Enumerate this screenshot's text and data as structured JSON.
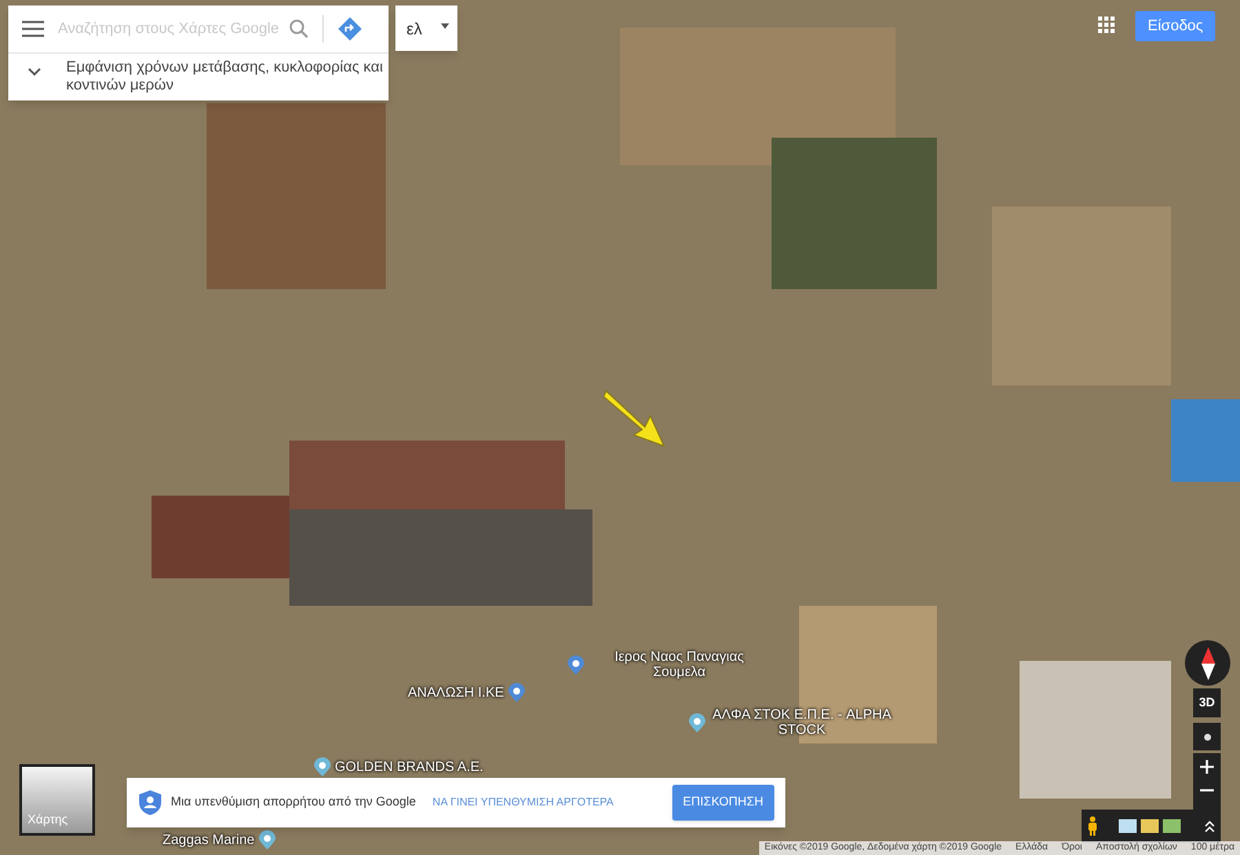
{
  "search": {
    "placeholder": "Αναζήτηση στους Χάρτες Google",
    "language": "ελ"
  },
  "transit_hint": "Εμφάνιση χρόνων μετάβασης, κυκλοφορίας και κοντινών μερών",
  "sign_in": "Είσοδος",
  "places": [
    {
      "label": "Ιερος Ναος Παναγιας Σουμελα",
      "kind": "church"
    },
    {
      "label": "ΑΝΑΛΩΣΗ Ι.ΚΕ",
      "kind": "shop"
    },
    {
      "label": "ΑΛΦΑ ΣΤΟΚ Ε.Π.Ε. - ALPHA STOCK",
      "kind": "pin"
    },
    {
      "label": "GOLDEN BRANDS A.E.",
      "kind": "pin"
    },
    {
      "label": "Zaggas Marine",
      "kind": "pin"
    }
  ],
  "layer_toggle": "Χάρτης",
  "privacy": {
    "message": "Μια υπενθύμιση απορρήτου από την Google",
    "later": "ΝΑ ΓΙΝΕΙ ΥΠΕΝΘΥΜΙΣΗ ΑΡΓΟΤΕΡΑ",
    "review": "ΕΠΙΣΚΟΠΗΣΗ"
  },
  "controls": {
    "tilt": "3D"
  },
  "footer": [
    "Εικόνες ©2019 Google, Δεδομένα χάρτη ©2019 Google",
    "Ελλάδα",
    "Όροι",
    "Αποστολή σχολίων",
    "100 μέτρα"
  ]
}
